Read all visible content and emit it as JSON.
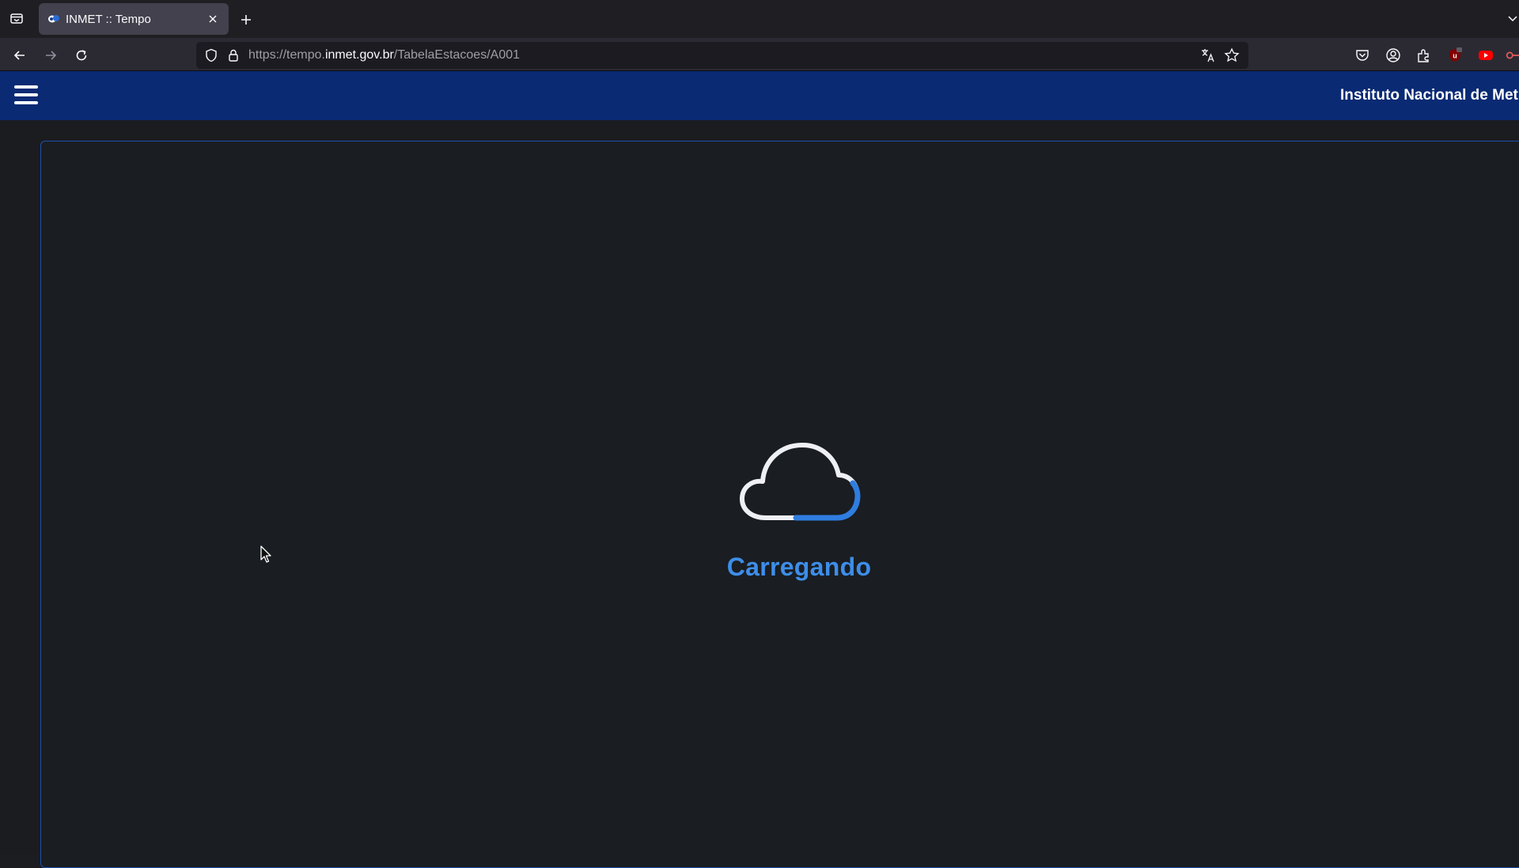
{
  "browser": {
    "tab": {
      "title": "INMET :: Tempo"
    },
    "url": {
      "prefix": "https://tempo.",
      "host": "inmet.gov.br",
      "path": "/TabelaEstacoes/A001"
    }
  },
  "header": {
    "title": "Instituto Nacional de Met"
  },
  "loader": {
    "text": "Carregando"
  },
  "colors": {
    "header_bg": "#0a2a74",
    "accent": "#3d8ee8",
    "panel_border": "#1e4fae",
    "page_bg": "#1a1c20"
  },
  "icons": [
    "tab-list-icon",
    "favicon-icon",
    "close-icon",
    "plus-icon",
    "back-arrow-icon",
    "forward-arrow-icon",
    "reload-icon",
    "shield-icon",
    "lock-icon",
    "translate-icon",
    "star-icon",
    "pocket-icon",
    "account-icon",
    "extensions-icon",
    "ublock-icon",
    "youtube-icon",
    "extension-icon",
    "hamburger-menu-icon",
    "cloud-loader-icon",
    "mouse-cursor-icon"
  ]
}
